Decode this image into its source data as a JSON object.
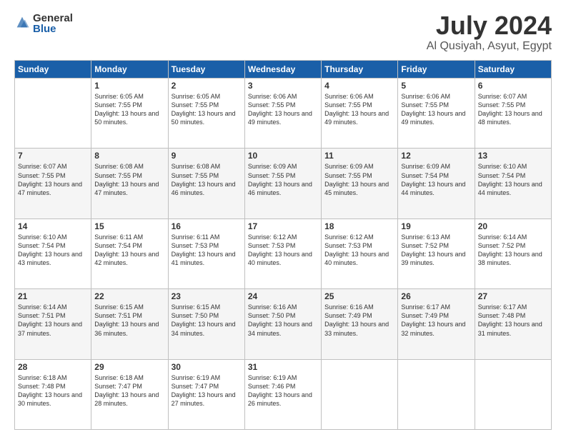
{
  "logo": {
    "general": "General",
    "blue": "Blue"
  },
  "title": "July 2024",
  "location": "Al Qusiyah, Asyut, Egypt",
  "days_header": [
    "Sunday",
    "Monday",
    "Tuesday",
    "Wednesday",
    "Thursday",
    "Friday",
    "Saturday"
  ],
  "weeks": [
    {
      "days": [
        {
          "num": "",
          "sunrise": "",
          "sunset": "",
          "daylight": ""
        },
        {
          "num": "1",
          "sunrise": "Sunrise: 6:05 AM",
          "sunset": "Sunset: 7:55 PM",
          "daylight": "Daylight: 13 hours and 50 minutes."
        },
        {
          "num": "2",
          "sunrise": "Sunrise: 6:05 AM",
          "sunset": "Sunset: 7:55 PM",
          "daylight": "Daylight: 13 hours and 50 minutes."
        },
        {
          "num": "3",
          "sunrise": "Sunrise: 6:06 AM",
          "sunset": "Sunset: 7:55 PM",
          "daylight": "Daylight: 13 hours and 49 minutes."
        },
        {
          "num": "4",
          "sunrise": "Sunrise: 6:06 AM",
          "sunset": "Sunset: 7:55 PM",
          "daylight": "Daylight: 13 hours and 49 minutes."
        },
        {
          "num": "5",
          "sunrise": "Sunrise: 6:06 AM",
          "sunset": "Sunset: 7:55 PM",
          "daylight": "Daylight: 13 hours and 49 minutes."
        },
        {
          "num": "6",
          "sunrise": "Sunrise: 6:07 AM",
          "sunset": "Sunset: 7:55 PM",
          "daylight": "Daylight: 13 hours and 48 minutes."
        }
      ]
    },
    {
      "days": [
        {
          "num": "7",
          "sunrise": "Sunrise: 6:07 AM",
          "sunset": "Sunset: 7:55 PM",
          "daylight": "Daylight: 13 hours and 47 minutes."
        },
        {
          "num": "8",
          "sunrise": "Sunrise: 6:08 AM",
          "sunset": "Sunset: 7:55 PM",
          "daylight": "Daylight: 13 hours and 47 minutes."
        },
        {
          "num": "9",
          "sunrise": "Sunrise: 6:08 AM",
          "sunset": "Sunset: 7:55 PM",
          "daylight": "Daylight: 13 hours and 46 minutes."
        },
        {
          "num": "10",
          "sunrise": "Sunrise: 6:09 AM",
          "sunset": "Sunset: 7:55 PM",
          "daylight": "Daylight: 13 hours and 46 minutes."
        },
        {
          "num": "11",
          "sunrise": "Sunrise: 6:09 AM",
          "sunset": "Sunset: 7:55 PM",
          "daylight": "Daylight: 13 hours and 45 minutes."
        },
        {
          "num": "12",
          "sunrise": "Sunrise: 6:09 AM",
          "sunset": "Sunset: 7:54 PM",
          "daylight": "Daylight: 13 hours and 44 minutes."
        },
        {
          "num": "13",
          "sunrise": "Sunrise: 6:10 AM",
          "sunset": "Sunset: 7:54 PM",
          "daylight": "Daylight: 13 hours and 44 minutes."
        }
      ]
    },
    {
      "days": [
        {
          "num": "14",
          "sunrise": "Sunrise: 6:10 AM",
          "sunset": "Sunset: 7:54 PM",
          "daylight": "Daylight: 13 hours and 43 minutes."
        },
        {
          "num": "15",
          "sunrise": "Sunrise: 6:11 AM",
          "sunset": "Sunset: 7:54 PM",
          "daylight": "Daylight: 13 hours and 42 minutes."
        },
        {
          "num": "16",
          "sunrise": "Sunrise: 6:11 AM",
          "sunset": "Sunset: 7:53 PM",
          "daylight": "Daylight: 13 hours and 41 minutes."
        },
        {
          "num": "17",
          "sunrise": "Sunrise: 6:12 AM",
          "sunset": "Sunset: 7:53 PM",
          "daylight": "Daylight: 13 hours and 40 minutes."
        },
        {
          "num": "18",
          "sunrise": "Sunrise: 6:12 AM",
          "sunset": "Sunset: 7:53 PM",
          "daylight": "Daylight: 13 hours and 40 minutes."
        },
        {
          "num": "19",
          "sunrise": "Sunrise: 6:13 AM",
          "sunset": "Sunset: 7:52 PM",
          "daylight": "Daylight: 13 hours and 39 minutes."
        },
        {
          "num": "20",
          "sunrise": "Sunrise: 6:14 AM",
          "sunset": "Sunset: 7:52 PM",
          "daylight": "Daylight: 13 hours and 38 minutes."
        }
      ]
    },
    {
      "days": [
        {
          "num": "21",
          "sunrise": "Sunrise: 6:14 AM",
          "sunset": "Sunset: 7:51 PM",
          "daylight": "Daylight: 13 hours and 37 minutes."
        },
        {
          "num": "22",
          "sunrise": "Sunrise: 6:15 AM",
          "sunset": "Sunset: 7:51 PM",
          "daylight": "Daylight: 13 hours and 36 minutes."
        },
        {
          "num": "23",
          "sunrise": "Sunrise: 6:15 AM",
          "sunset": "Sunset: 7:50 PM",
          "daylight": "Daylight: 13 hours and 34 minutes."
        },
        {
          "num": "24",
          "sunrise": "Sunrise: 6:16 AM",
          "sunset": "Sunset: 7:50 PM",
          "daylight": "Daylight: 13 hours and 34 minutes."
        },
        {
          "num": "25",
          "sunrise": "Sunrise: 6:16 AM",
          "sunset": "Sunset: 7:49 PM",
          "daylight": "Daylight: 13 hours and 33 minutes."
        },
        {
          "num": "26",
          "sunrise": "Sunrise: 6:17 AM",
          "sunset": "Sunset: 7:49 PM",
          "daylight": "Daylight: 13 hours and 32 minutes."
        },
        {
          "num": "27",
          "sunrise": "Sunrise: 6:17 AM",
          "sunset": "Sunset: 7:48 PM",
          "daylight": "Daylight: 13 hours and 31 minutes."
        }
      ]
    },
    {
      "days": [
        {
          "num": "28",
          "sunrise": "Sunrise: 6:18 AM",
          "sunset": "Sunset: 7:48 PM",
          "daylight": "Daylight: 13 hours and 30 minutes."
        },
        {
          "num": "29",
          "sunrise": "Sunrise: 6:18 AM",
          "sunset": "Sunset: 7:47 PM",
          "daylight": "Daylight: 13 hours and 28 minutes."
        },
        {
          "num": "30",
          "sunrise": "Sunrise: 6:19 AM",
          "sunset": "Sunset: 7:47 PM",
          "daylight": "Daylight: 13 hours and 27 minutes."
        },
        {
          "num": "31",
          "sunrise": "Sunrise: 6:19 AM",
          "sunset": "Sunset: 7:46 PM",
          "daylight": "Daylight: 13 hours and 26 minutes."
        },
        {
          "num": "",
          "sunrise": "",
          "sunset": "",
          "daylight": ""
        },
        {
          "num": "",
          "sunrise": "",
          "sunset": "",
          "daylight": ""
        },
        {
          "num": "",
          "sunrise": "",
          "sunset": "",
          "daylight": ""
        }
      ]
    }
  ]
}
